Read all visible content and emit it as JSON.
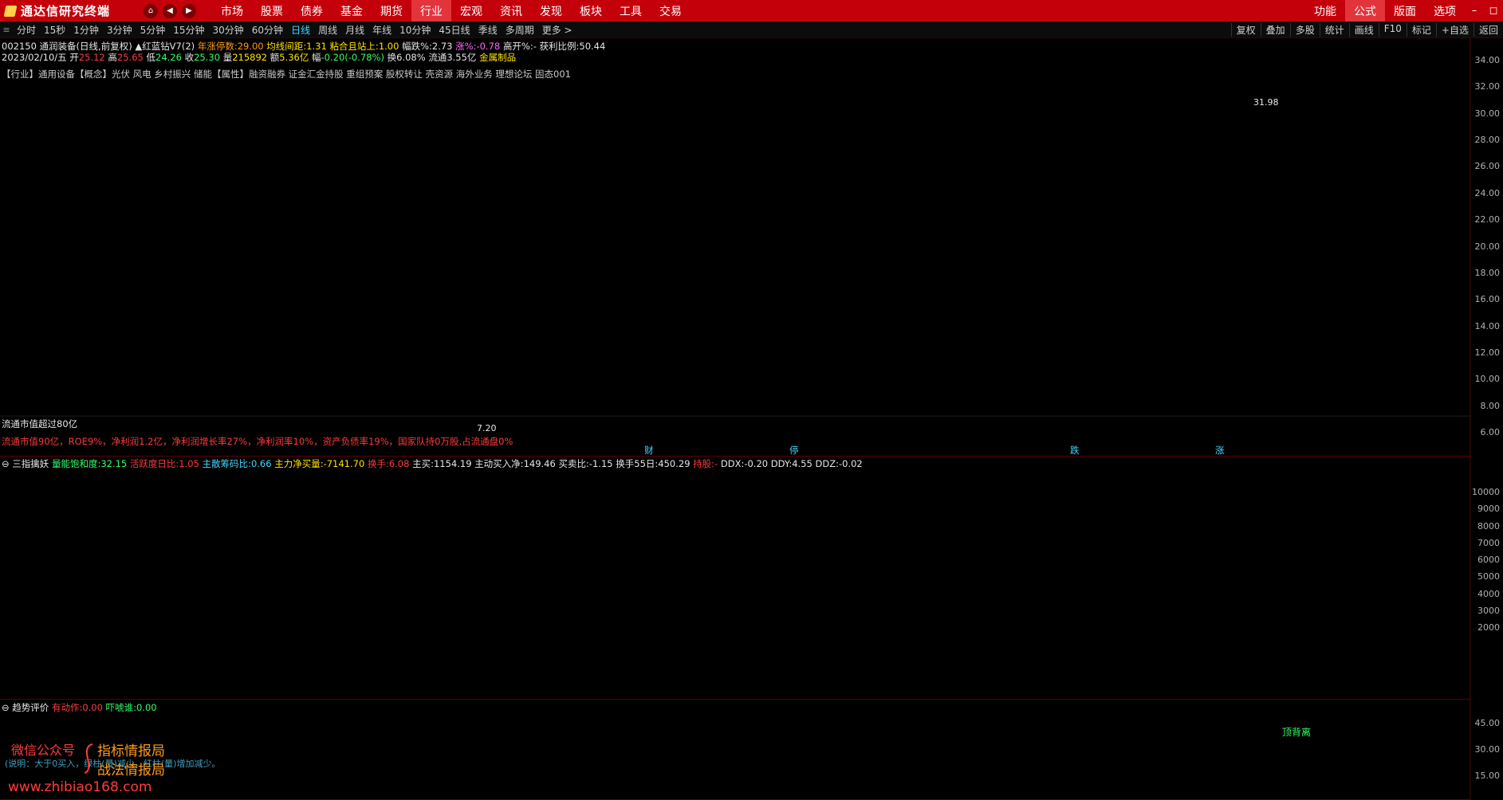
{
  "app": {
    "title": "通达信研究终端",
    "colors": {
      "menubar": "#c4000a",
      "active": "#e3333b",
      "up": "#ff3b3b",
      "down": "#40d8ff",
      "magenta": "#ff00ff",
      "yellow": "#ffe400"
    }
  },
  "menubar": {
    "nav": {
      "home": "⌂",
      "back": "◀",
      "forward": "▶"
    },
    "items": [
      "市场",
      "股票",
      "债券",
      "基金",
      "期货",
      "行业",
      "宏观",
      "资讯",
      "发现",
      "板块",
      "工具",
      "交易"
    ],
    "active_item": "行业",
    "right_items": [
      "功能",
      "公式",
      "版面",
      "选项"
    ],
    "right_active": "公式",
    "window_buttons": {
      "minimize": "–",
      "restore": "◻"
    }
  },
  "periodbar": {
    "icon": "≡",
    "periods": [
      "分时",
      "15秒",
      "1分钟",
      "3分钟",
      "5分钟",
      "15分钟",
      "30分钟",
      "60分钟",
      "日线",
      "周线",
      "月线",
      "年线",
      "10分钟",
      "45日线",
      "季线",
      "多周期",
      "更多 >"
    ],
    "active_period": "日线",
    "tools": [
      "复权",
      "叠加",
      "多股",
      "统计",
      "画线",
      "F10",
      "标记",
      "+自选",
      "返回"
    ]
  },
  "info": {
    "stock": "002150 通润装备(日线,前复权)",
    "indicator": "▲红蓝钻V7(2)",
    "limit_up_label": "年涨停数:",
    "limit_up_value": "29.00",
    "ma_gap_label": "均线间距:",
    "ma_gap_value": "1.31",
    "sticky_label": "粘合且站上:",
    "sticky_value": "1.00",
    "drop_label": "幅跌%:",
    "drop_value": "2.73",
    "rise_label": "涨%:",
    "rise_value": "-0.78",
    "gap_label": "高开%:",
    "gap_value": "-",
    "profit_label": "获利比例:",
    "profit_value": "50.44",
    "date": "2023/02/10/五",
    "open_label": "开",
    "open_value": "25.12",
    "high_label": "高",
    "high_value": "25.65",
    "low_label": "低",
    "low_value": "24.26",
    "close_label": "收",
    "close_value": "25.30",
    "vol_label": "量",
    "vol_value": "215892",
    "amount_label": "额",
    "amount_value": "5.36亿",
    "change_label": "幅",
    "change_value": "-0.20(-0.78%)",
    "turnover_label": "换",
    "turnover_value": "6.08%",
    "float_label": "流通",
    "float_value": "3.55亿",
    "sector": "金属制品",
    "tags": "【行业】通用设备【概念】光伏 风电 乡村振兴 储能【属性】融资融券 证金汇金持股 重组预案 股权转让 壳资源 海外业务 理想论坛 固态001"
  },
  "panel1": {
    "price_high_label": "31.98",
    "price_low_label": "7.20",
    "mktcap_note": "流通市值超过80亿",
    "fund_note": "流通市值90亿，ROE9%，净利润1.2亿，净利润增长率27%，净利润率10%，资产负债率19%，国家队持0万股,占流通盘0%",
    "events": [
      "财",
      "停",
      "跌",
      "涨"
    ],
    "axis_ticks": [
      "34.00",
      "32.00",
      "30.00",
      "28.00",
      "26.00",
      "24.00",
      "22.00",
      "20.00",
      "18.00",
      "16.00",
      "14.00",
      "12.00",
      "10.00",
      "8.00",
      "6.00"
    ]
  },
  "panel2": {
    "title": "三指擒妖",
    "saturation_label": "量能饱和度:",
    "saturation_value": "32.15",
    "demon_label": "活跃度日比:",
    "demon_value": "1.05",
    "chips_label": "主散筹码比:",
    "chips_value": "0.66",
    "net_label": "主力净买量:",
    "net_value": "-7141.70",
    "turnover_label": "换手:",
    "turnover_value": "6.08",
    "buy_label": "主买:",
    "buy_value": "1154.19",
    "active_label": "主动买入净:",
    "active_value": "149.46",
    "ratio_label": "买卖比:",
    "ratio_value": "-1.15",
    "t55_label": "换手55日:",
    "t55_value": "450.29",
    "hold_label": "持股:",
    "hold_value": "-",
    "ddx_label": "DDX:",
    "ddx_value": "-0.20",
    "ddy_label": "DDY:",
    "ddy_value": "4.55",
    "ddz_label": "DDZ:",
    "ddz_value": "-0.02",
    "axis_ticks": [
      "10000",
      "9000",
      "8000",
      "7000",
      "6000",
      "5000",
      "4000",
      "3000",
      "2000"
    ]
  },
  "panel3": {
    "title": "趋势评价",
    "action_label": "有动作:",
    "action_value": "0.00",
    "crazy_label": "吓唬谁:",
    "crazy_value": "0.00",
    "divergence_note": "顶背离",
    "axis_ticks": [
      "45.00",
      "30.00",
      "15.00"
    ]
  },
  "watermark": {
    "line1": "微信公众号",
    "brand1": "指标情报局",
    "brand2": "战法情报局",
    "hint": "(说明：大于0买入，绿柱(量)减少，红柱(量)增加减少。",
    "url": "www.zhibiao168.com"
  }
}
